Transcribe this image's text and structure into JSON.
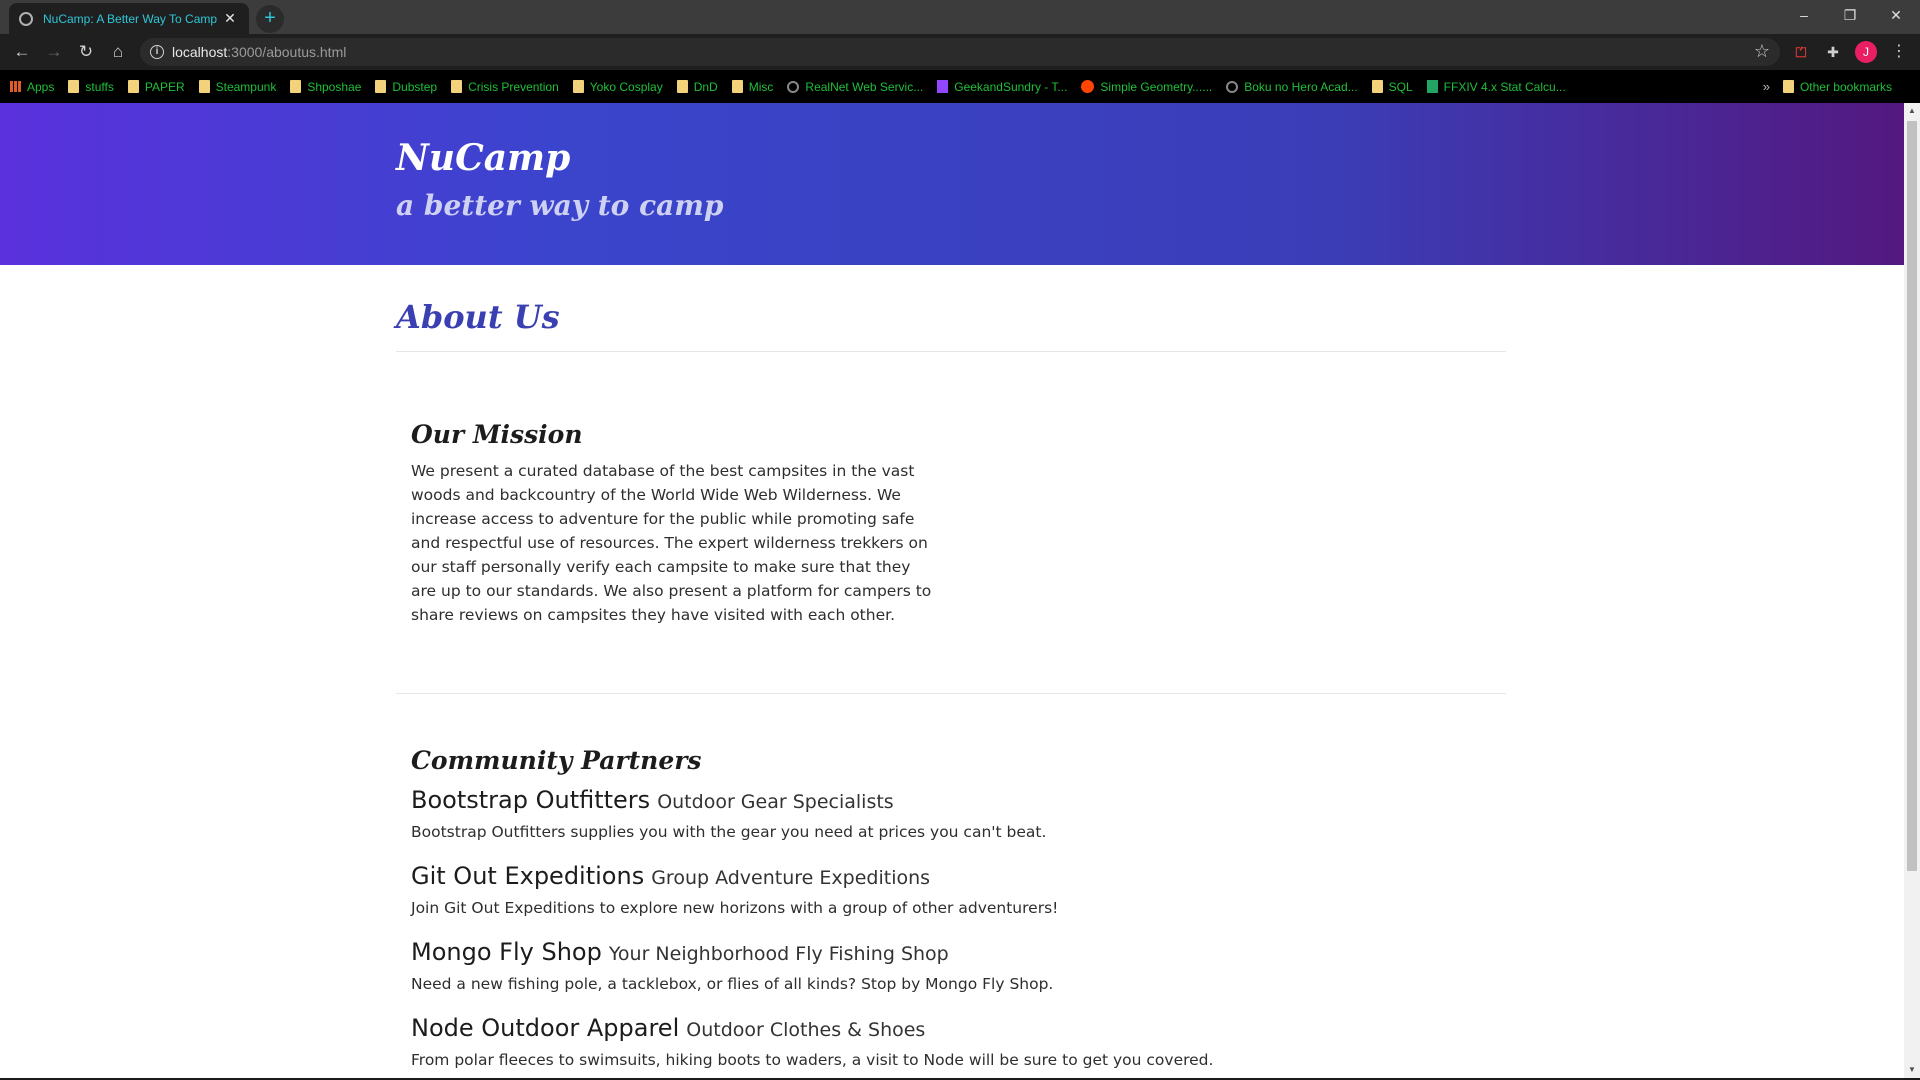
{
  "browser": {
    "tab_title": "NuCamp: A Better Way To Camp",
    "tab_close": "✕",
    "new_tab": "+",
    "url_host": "localhost",
    "url_path": ":3000/aboutus.html",
    "window_controls": [
      "–",
      "❐",
      "✕"
    ],
    "avatar_letter": "J",
    "bookmarks": [
      {
        "label": "Apps",
        "icon": "apps-grid-icon"
      },
      {
        "label": "stuffs",
        "icon": "folder-icon"
      },
      {
        "label": "PAPER",
        "icon": "folder-icon"
      },
      {
        "label": "Steampunk",
        "icon": "folder-icon"
      },
      {
        "label": "Shposhae",
        "icon": "folder-icon"
      },
      {
        "label": "Dubstep",
        "icon": "folder-icon"
      },
      {
        "label": "Crisis Prevention",
        "icon": "folder-icon"
      },
      {
        "label": "Yoko Cosplay",
        "icon": "folder-icon"
      },
      {
        "label": "DnD",
        "icon": "folder-icon"
      },
      {
        "label": "Misc",
        "icon": "folder-icon"
      },
      {
        "label": "RealNet Web Servic...",
        "icon": "globe-icon"
      },
      {
        "label": "GeekandSundry - T...",
        "icon": "twitch-icon"
      },
      {
        "label": "Simple Geometry......",
        "icon": "reddit-icon"
      },
      {
        "label": "Boku no Hero Acad...",
        "icon": "site-icon"
      },
      {
        "label": "SQL",
        "icon": "folder-icon"
      },
      {
        "label": "FFXIV 4.x Stat Calcu...",
        "icon": "sheets-icon"
      }
    ],
    "more_bookmarks": "»",
    "other_bookmarks": "Other bookmarks"
  },
  "header": {
    "title": "NuCamp",
    "tagline": "a better way to camp"
  },
  "page": {
    "heading": "About Us",
    "mission": {
      "title": "Our Mission",
      "text": "We present a curated database of the best campsites in the vast woods and backcountry of the World Wide Web Wilderness. We increase access to adventure for the public while promoting safe and respectful use of resources. The expert wilderness trekkers on our staff personally verify each campsite to make sure that they are up to our standards. We also present a platform for campers to share reviews on campsites they have visited with each other."
    },
    "partners": {
      "title": "Community Partners",
      "items": [
        {
          "name": "Bootstrap Outfitters",
          "subtitle": "Outdoor Gear Specialists",
          "description": "Bootstrap Outfitters supplies you with the gear you need at prices you can't beat."
        },
        {
          "name": "Git Out Expeditions",
          "subtitle": "Group Adventure Expeditions",
          "description": "Join Git Out Expeditions to explore new horizons with a group of other adventurers!"
        },
        {
          "name": "Mongo Fly Shop",
          "subtitle": "Your Neighborhood Fly Fishing Shop",
          "description": "Need a new fishing pole, a tacklebox, or flies of all kinds? Stop by Mongo Fly Shop."
        },
        {
          "name": "Node Outdoor Apparel",
          "subtitle": "Outdoor Clothes & Shoes",
          "description": "From polar fleeces to swimsuits, hiking boots to waders, a visit to Node will be sure to get you covered."
        }
      ]
    }
  },
  "colors": {
    "brand_blue": "#3a3fb2",
    "gradient_start": "#5a31dd",
    "gradient_end": "#541880",
    "bookmark_text": "#1fbf3a",
    "tab_title": "#2ec6d8"
  }
}
